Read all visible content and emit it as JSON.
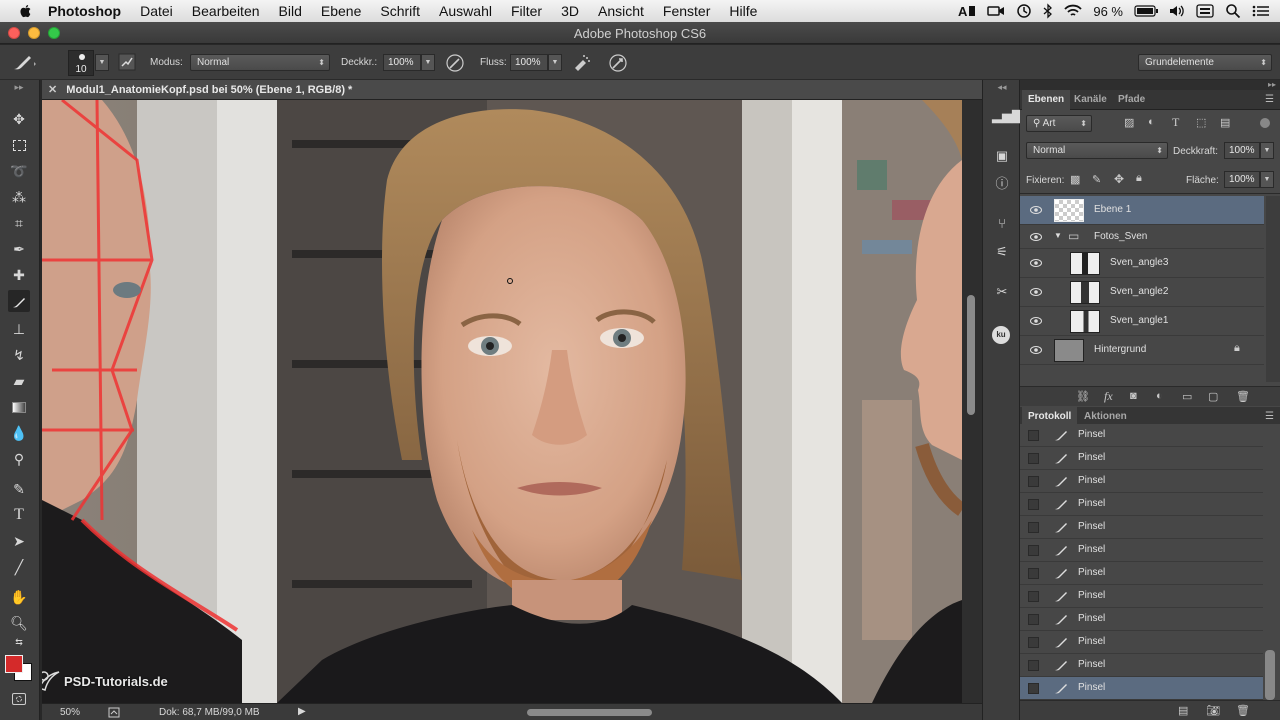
{
  "menubar": {
    "app_name": "Photoshop",
    "items": [
      "Datei",
      "Bearbeiten",
      "Bild",
      "Ebene",
      "Schrift",
      "Auswahl",
      "Filter",
      "3D",
      "Ansicht",
      "Fenster",
      "Hilfe"
    ],
    "battery": "96 %"
  },
  "window": {
    "title": "Adobe Photoshop CS6"
  },
  "options": {
    "brush_size": "10",
    "mode_label": "Modus:",
    "mode_value": "Normal",
    "opacity_label": "Deckkr.:",
    "opacity_value": "100%",
    "flow_label": "Fluss:",
    "flow_value": "100%",
    "workspace": "Grundelemente"
  },
  "document": {
    "tab_title": "Modul1_AnatomieKopf.psd bei 50% (Ebene 1, RGB/8) *",
    "zoom": "50%",
    "doc_info": "Dok: 68,7 MB/99,0 MB"
  },
  "watermark": "PSD-Tutorials.de",
  "colors": {
    "foreground": "#d42a2a",
    "background": "#ffffff",
    "selection": "#5b6b80",
    "panel": "#474747"
  },
  "layers_panel": {
    "tabs": [
      "Ebenen",
      "Kanäle",
      "Pfade"
    ],
    "filter": "Art",
    "blend_mode": "Normal",
    "opacity_label": "Deckkraft:",
    "opacity_value": "100%",
    "lock_label": "Fixieren:",
    "fill_label": "Fläche:",
    "fill_value": "100%",
    "layers": [
      {
        "name": "Ebene 1"
      },
      {
        "name": "Fotos_Sven"
      },
      {
        "name": "Sven_angle3"
      },
      {
        "name": "Sven_angle2"
      },
      {
        "name": "Sven_angle1"
      },
      {
        "name": "Hintergrund"
      }
    ]
  },
  "history_panel": {
    "tabs": [
      "Protokoll",
      "Aktionen"
    ],
    "items": [
      "Pinsel",
      "Pinsel",
      "Pinsel",
      "Pinsel",
      "Pinsel",
      "Pinsel",
      "Pinsel",
      "Pinsel",
      "Pinsel",
      "Pinsel",
      "Pinsel",
      "Pinsel"
    ]
  }
}
